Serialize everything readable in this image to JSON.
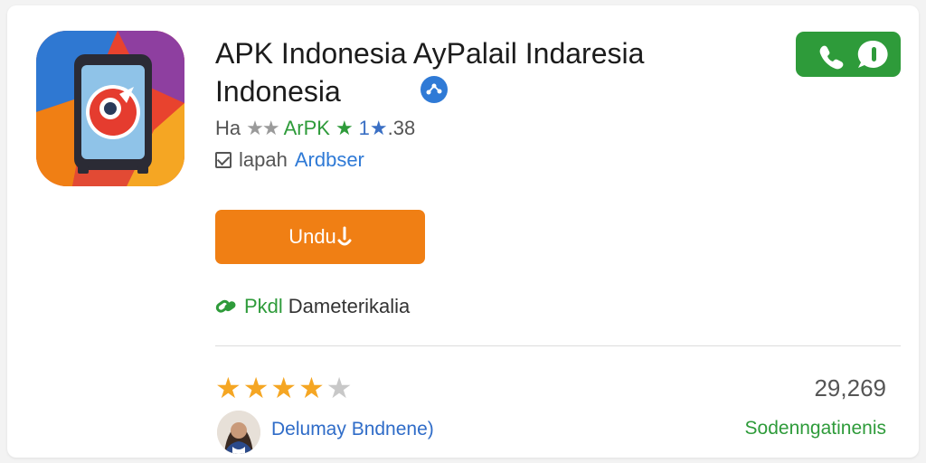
{
  "app": {
    "title_line1": "APK Indonesia AyPalail Indaresia",
    "title_line2": "Indonesia",
    "stats_prefix": "Ha",
    "stats_gray_stars": "★★",
    "stats_brand": "ArPK",
    "stats_green_star": "★",
    "stats_number": "1",
    "stats_blue_star": "★",
    "stats_suffix": ".38",
    "developer_prefix": "lapah",
    "developer_link": "Ardbser"
  },
  "actions": {
    "download_label": "Undu"
  },
  "verification": {
    "tag": "Pkdl",
    "text": "Dameterikalia"
  },
  "reviews": {
    "rating": 4,
    "max_rating": 5,
    "count": "29,269",
    "reviewer_name": "Delumay Bndnene)",
    "status": "Sodenngatinenis"
  },
  "colors": {
    "accent_green": "#2e9b3a",
    "download_orange": "#f07f14",
    "link_blue": "#2f7ad6",
    "star_gold": "#f5a623"
  },
  "icons": {
    "app": "app-logo-icon",
    "verified": "verified-badge-icon",
    "call": "phone-icon",
    "chat": "chat-bubble-icon",
    "download": "download-arrow-icon",
    "link": "link-icon"
  }
}
